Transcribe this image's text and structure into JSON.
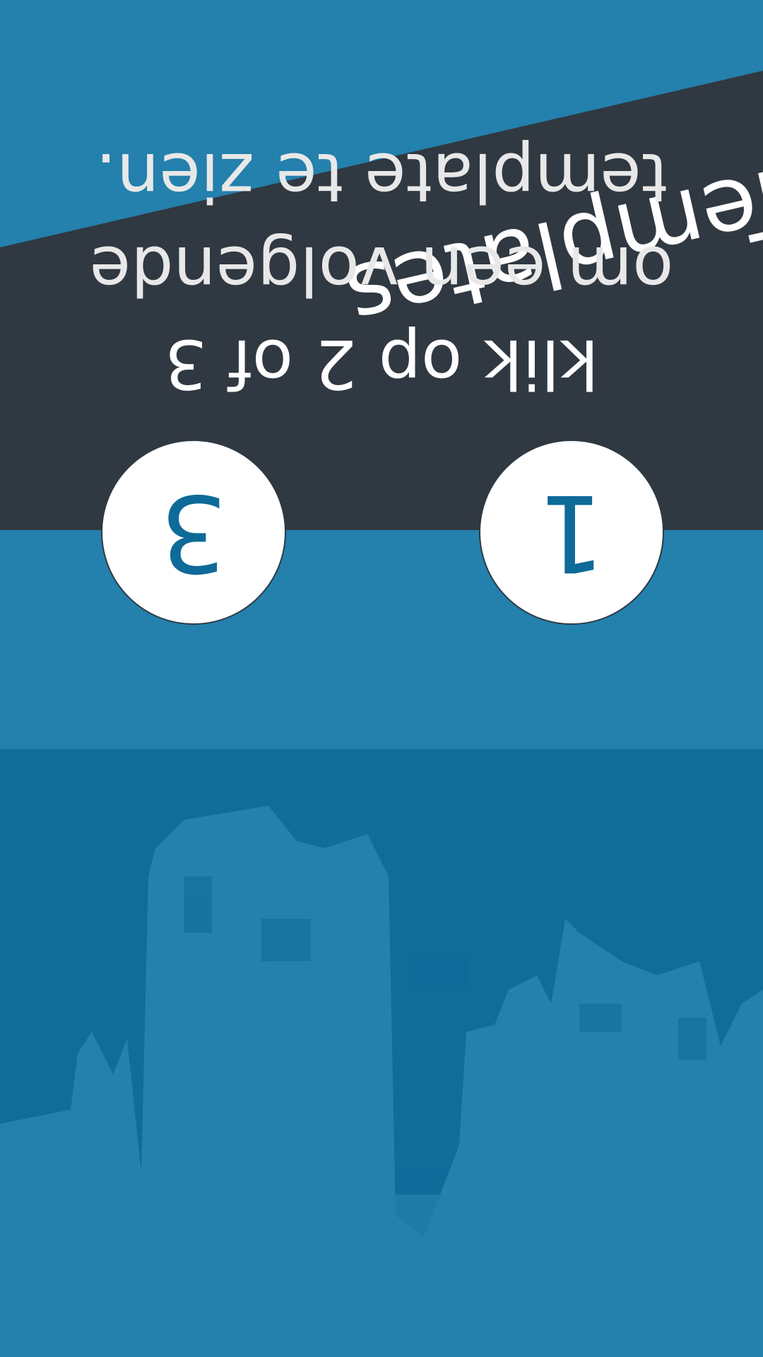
{
  "page": {
    "title": "Templates",
    "message_lines": [
      "klik op 2 of 3",
      "om een volgende",
      "template te zien."
    ]
  },
  "buttons": [
    {
      "label": "1"
    },
    {
      "label": "3"
    }
  ],
  "colors": {
    "background": "#2480ac",
    "skyline_band": "#0e6a98",
    "footer": "#303841",
    "button_fill": "#ffffff",
    "button_text": "#0e6a98",
    "text": "#ffffff"
  }
}
